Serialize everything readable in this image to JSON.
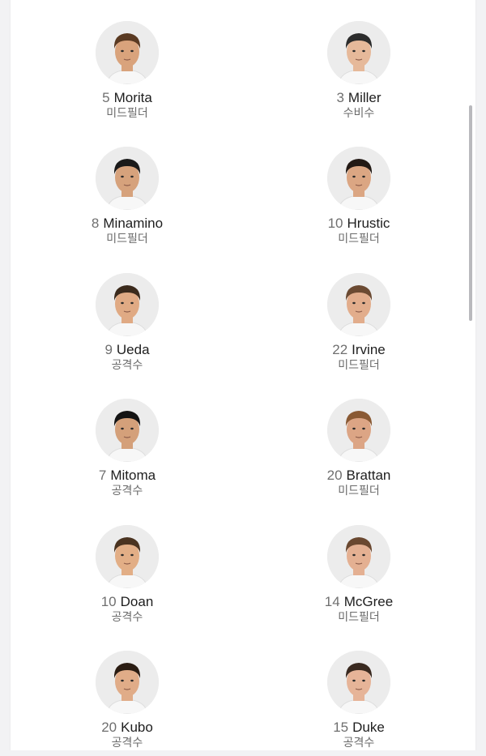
{
  "players": [
    {
      "number": "5",
      "name": "Morita",
      "position": "미드필더",
      "photo": "player-photo-icon",
      "hair": "#5a3a22",
      "skin": "#d9a37c"
    },
    {
      "number": "3",
      "name": "Miller",
      "position": "수비수",
      "photo": "player-photo-icon",
      "hair": "#2c2c2c",
      "skin": "#e6b99a"
    },
    {
      "number": "8",
      "name": "Minamino",
      "position": "미드필더",
      "photo": "player-photo-icon",
      "hair": "#1a1a1a",
      "skin": "#d6a27c"
    },
    {
      "number": "10",
      "name": "Hrustic",
      "position": "미드필더",
      "photo": "player-photo-icon",
      "hair": "#231a15",
      "skin": "#dba683"
    },
    {
      "number": "9",
      "name": "Ueda",
      "position": "공격수",
      "photo": "player-photo-icon",
      "hair": "#3b2a1c",
      "skin": "#e0aa84"
    },
    {
      "number": "22",
      "name": "Irvine",
      "position": "미드필더",
      "photo": "player-photo-icon",
      "hair": "#6b4a32",
      "skin": "#e2ad8c"
    },
    {
      "number": "7",
      "name": "Mitoma",
      "position": "공격수",
      "photo": "player-photo-icon",
      "hair": "#141414",
      "skin": "#d4a07a"
    },
    {
      "number": "20",
      "name": "Brattan",
      "position": "미드필더",
      "photo": "player-photo-icon",
      "hair": "#8a5a34",
      "skin": "#dca585"
    },
    {
      "number": "10",
      "name": "Doan",
      "position": "공격수",
      "photo": "player-photo-icon",
      "hair": "#4a3320",
      "skin": "#e2ae86"
    },
    {
      "number": "14",
      "name": "McGree",
      "position": "미드필더",
      "photo": "player-photo-icon",
      "hair": "#6a4830",
      "skin": "#e4b092"
    },
    {
      "number": "20",
      "name": "Kubo",
      "position": "공격수",
      "photo": "player-photo-icon",
      "hair": "#2a1c12",
      "skin": "#e0ac88"
    },
    {
      "number": "15",
      "name": "Duke",
      "position": "공격수",
      "photo": "player-photo-icon",
      "hair": "#3a2a20",
      "skin": "#e6b498"
    }
  ]
}
